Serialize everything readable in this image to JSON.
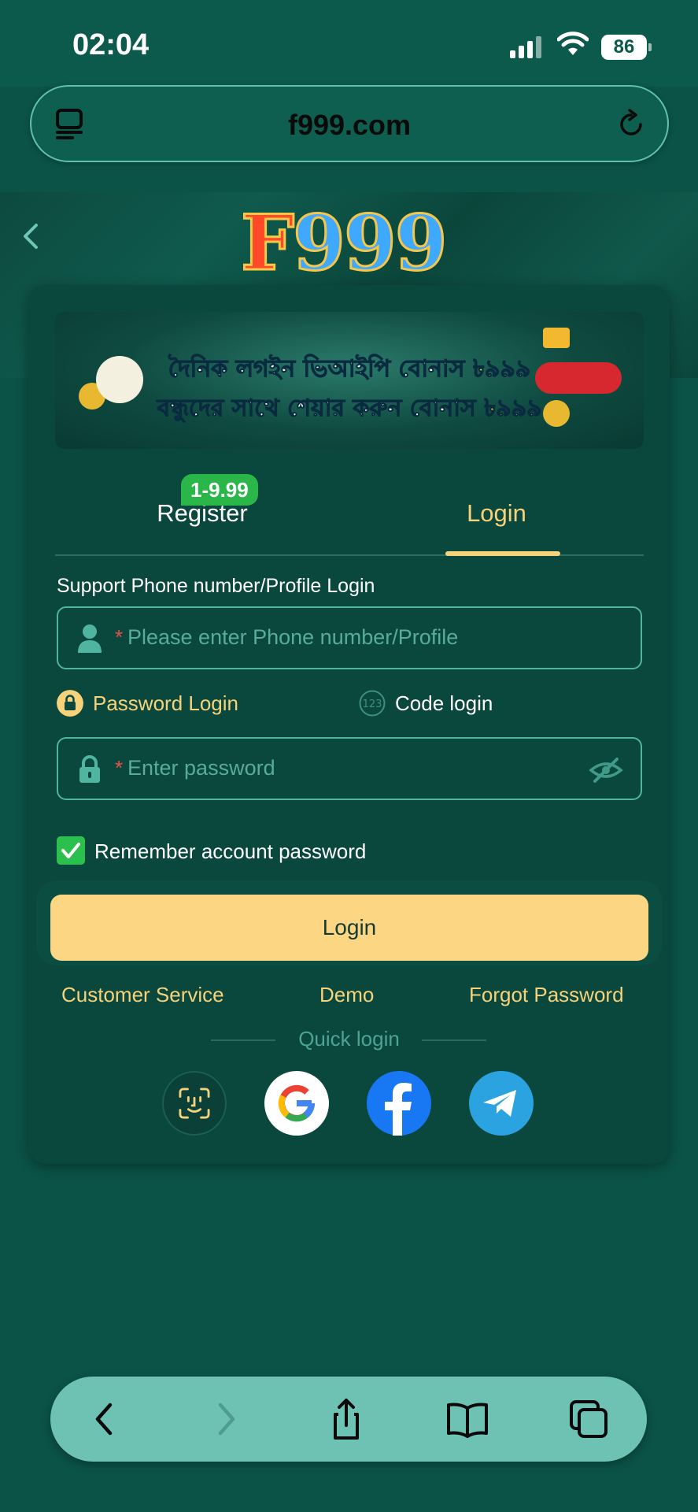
{
  "status_bar": {
    "time": "02:04",
    "battery": "86"
  },
  "browser": {
    "url": "f999.com"
  },
  "header": {
    "logo_f": "F",
    "logo_num": "999"
  },
  "promo": {
    "line1_text": "দৈনিক লগইন ভিআইপি বোনাস ",
    "line1_amount": "৳৯৯৯",
    "line2_text": "বন্ধুদের সাথে শেয়ার করুন বোনাস ",
    "line2_amount": "৳৯৯৯"
  },
  "tabs": {
    "register_label": "Register",
    "register_badge": "1-9.99",
    "login_label": "Login"
  },
  "form": {
    "phone_label": "Support Phone number/Profile Login",
    "phone_placeholder": "Please enter Phone number/Profile",
    "password_method": "Password Login",
    "code_method": "Code login",
    "code_icon_text": "123",
    "password_placeholder": "Enter password",
    "remember_label": "Remember account password",
    "remember_checked": true,
    "login_button": "Login"
  },
  "links": {
    "customer_service": "Customer Service",
    "demo": "Demo",
    "forgot_password": "Forgot Password"
  },
  "quick_login": {
    "label": "Quick login",
    "providers": [
      "face-id",
      "google",
      "facebook",
      "telegram"
    ]
  },
  "colors": {
    "background": "#0b5347",
    "card": "#0a473d",
    "accent_gold": "#f6d27a",
    "button": "#fcd683",
    "input_border": "#4fb5a1",
    "checkbox": "#2bc04d",
    "toolbar": "#6ec2b3"
  }
}
